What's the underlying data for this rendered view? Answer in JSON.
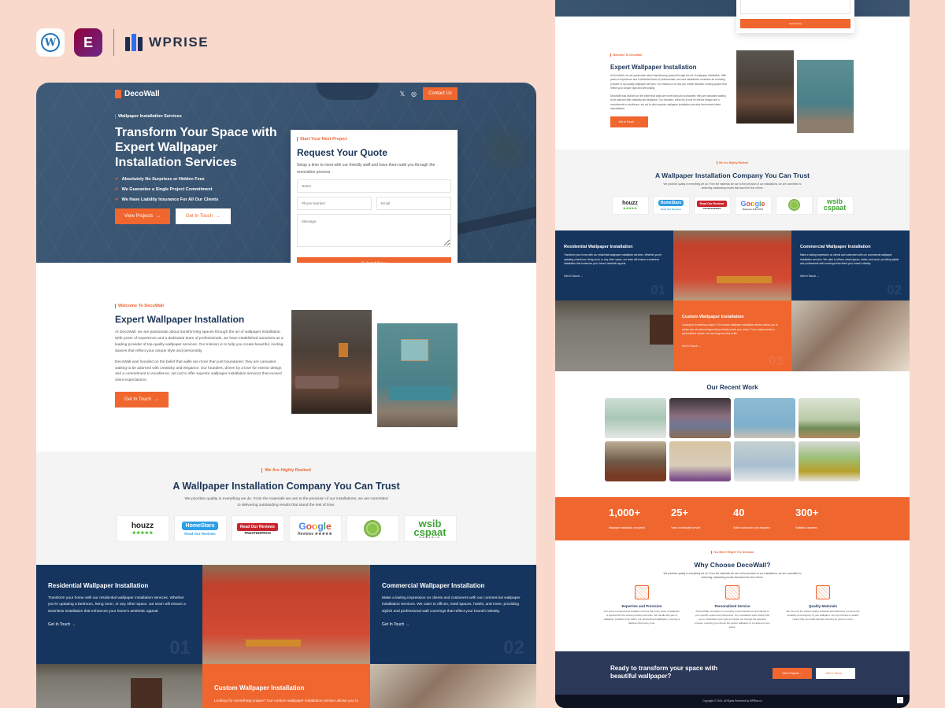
{
  "brand_bar": {
    "wordpress_icon": "wordpress-icon",
    "elementor_icon": "elementor-icon",
    "wordpress_glyph": "W",
    "elementor_glyph": "E",
    "vendor_name": "WPRISE"
  },
  "site": {
    "logo_text": "DecoWall",
    "nav": {
      "social_x": "𝕏",
      "social_instagram": "◎",
      "contact_button": "Contact Us"
    },
    "hero": {
      "kicker": "Wallpaper Installation Services",
      "title": "Transform Your Space with Expert Wallpaper Installation Services",
      "check_glyph": "✔",
      "checks": [
        "Absolutely No Surprises or Hidden Fees",
        "We Guarantee a Single Project Commitment",
        "We Have Liability Insurance For All Our Clients"
      ],
      "view_projects": "View Projects",
      "get_in_touch": "Get In Touch",
      "arrow": "→"
    },
    "quote_form": {
      "kicker": "Start Your Next Project",
      "title": "Request Your Quote",
      "description": "Setup a time to meet with our friendly staff and have them walk you through the renovation process",
      "name_placeholder": "Name",
      "phone_placeholder": "Phone Number",
      "email_placeholder": "Email",
      "message_placeholder": "Message",
      "submit": "Submit Now"
    },
    "about": {
      "kicker": "Welcome To DecoWall",
      "title": "Expert Wallpaper Installation",
      "paragraph1": "At DecoWall, we are passionate about transforming spaces through the art of wallpaper installation. With years of experience and a dedicated team of professionals, we have established ourselves as a leading provider of top-quality wallpaper services. Our mission is to help you create beautiful, inviting spaces that reflect your unique style and personality.",
      "paragraph2": "DecoWall was founded on the belief that walls are more than just boundaries; they are canvases waiting to be adorned with creativity and elegance. Our founders, driven by a love for interior design and a commitment to excellence, set out to offer superior wallpaper installation services that exceed client expectations.",
      "button": "Get In Touch"
    },
    "trust": {
      "kicker": "We Are Highly Ranked",
      "title": "A Wallpaper Installation Company You Can Trust",
      "description": "We prioritize quality in everything we do. From the materials we use to the precision of our installations, we are committed to delivering outstanding results that stand the test of time.",
      "badges": {
        "houzz": "houzz",
        "houzz_stars": "★★★★★",
        "homestars": "HomeStars",
        "homestars_sub": "Read Our Reviews",
        "trusted": "Read Our Reviews",
        "trusted_sub": "TRUSTEDPROS",
        "google": "Google",
        "google_sub": "Reviews ★★★★★",
        "wsib": "wsib cspaat",
        "wsib_sub": "ONTARIO"
      }
    },
    "services": [
      {
        "title": "Residential Wallpaper Installation",
        "text": "Transform your home with our residential wallpaper installation services. Whether you're updating a bedroom, living room, or any other space, our team will ensure a seamless installation that enhances your home's aesthetic appeal.",
        "link": "Get In Touch →",
        "number": "01"
      },
      {
        "title": "Commercial Wallpaper Installation",
        "text": "Make a lasting impression on clients and customers with our commercial wallpaper installation services. We cater to offices, retail spaces, hotels, and more, providing stylish and professional wall coverings that reflect your brand's identity.",
        "link": "Get In Touch →",
        "number": "02"
      },
      {
        "title": "Custom Wallpaper Installation",
        "text": "Looking for something unique? Our custom wallpaper installation service allows you to create one-of-a-kind designs that perfectly match your vision. From custom prints to personalized murals, we can bring any idea to life.",
        "link": "Get In Touch →",
        "number": "03"
      }
    ],
    "recent_work": {
      "title": "Our Recent Work"
    },
    "stats": [
      {
        "value": "1,000+",
        "label": "Wallpaper installation completed"
      },
      {
        "value": "25+",
        "label": "Years of dedicated service"
      },
      {
        "value": "40",
        "label": "Skilled contractors and designers"
      },
      {
        "value": "300+",
        "label": "Satisfied customers"
      }
    ],
    "why": {
      "kicker": "You Won't Regret The Decision",
      "title": "Why Choose DecoWall?",
      "description": "We prioritize quality in everything we do. From the materials we use to the precision of our installations, we are committed to delivering outstanding results that stand the test of time.",
      "features": [
        {
          "title": "Expertise and Precision",
          "text": "Our team of experienced installers ensures that every piece of wallpaper is applied with the utmost precision and care. We handle all types of wallpaper, including vinyl, fabric, foil, and textured wallpapers, ensuring a flawless finish every time."
        },
        {
          "title": "Personalized Service",
          "text": "At DecoWall, we believe in providing a personalized service tailored to your specific needs and preferences. Our consultants work closely with you to understand your style and guide you through the selection process, ensuring you choose the perfect wallpaper to complement your space."
        },
        {
          "title": "Quality Materials",
          "text": "We use only the highest quality materials and adhesives to ensure the durability and longevity of your wallpaper. Our commitment to quality means that your walls will look stunning for years to come."
        }
      ]
    },
    "cta": {
      "title": "Ready to transform your space with beautiful wallpaper?",
      "view_projects": "View Projects →",
      "get_in_touch": "Get In Touch →"
    },
    "footer": {
      "copyright": "Copyright © 2024. All Rights Reserved by WPRise.co",
      "to_top": "^"
    }
  },
  "colors": {
    "accent": "#f0662f",
    "navy": "#15355f",
    "heading": "#1c3558",
    "backdrop": "#f8d9cb",
    "cta_bg": "#2c3858",
    "footer_bg": "#0e1322"
  }
}
